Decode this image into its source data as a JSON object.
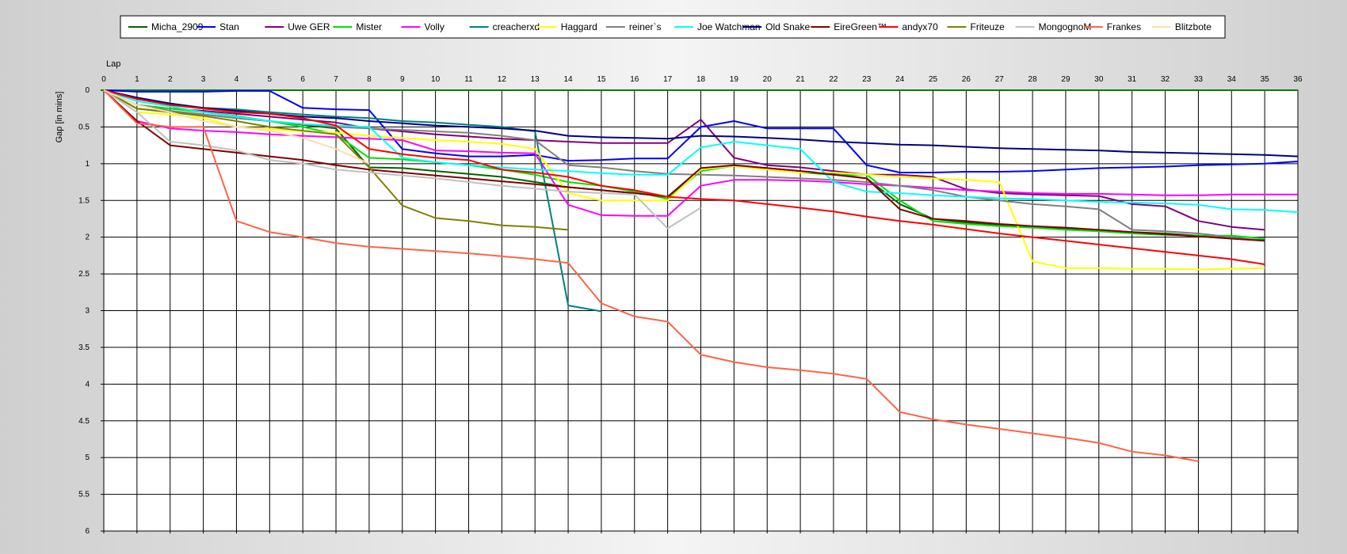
{
  "chart_data": {
    "type": "line",
    "title": "",
    "xlabel": "Lap",
    "ylabel": "Gap [in mins]",
    "xlim": [
      0,
      36
    ],
    "ylim": [
      0,
      6
    ],
    "y_inverted": true,
    "grid": true,
    "legend_position": "top",
    "x_ticks": [
      0,
      1,
      2,
      3,
      4,
      5,
      6,
      7,
      8,
      9,
      10,
      11,
      12,
      13,
      14,
      15,
      16,
      17,
      18,
      19,
      20,
      21,
      22,
      23,
      24,
      25,
      26,
      27,
      28,
      29,
      30,
      31,
      32,
      33,
      34,
      35,
      36
    ],
    "y_ticks": [
      0,
      0.5,
      1,
      1.5,
      2,
      2.5,
      3,
      3.5,
      4,
      4.5,
      5,
      5.5,
      6
    ],
    "y_tick_labels": [
      "0",
      "0.5",
      "1",
      "1.5",
      "2",
      "2.5",
      "3",
      "3.5",
      "4",
      "4.5",
      "5",
      "5.5",
      "6"
    ],
    "zero_line_color": "#008000",
    "series": [
      {
        "name": "Micha_2909",
        "color": "#006400",
        "x": [
          0,
          1,
          2,
          3,
          4,
          5,
          6,
          7,
          8,
          9,
          10,
          11,
          12,
          13,
          14,
          15,
          16,
          17,
          18,
          19,
          20,
          21,
          22,
          23,
          24,
          25,
          26,
          27,
          28,
          29,
          30,
          31,
          32,
          33,
          34,
          35
        ],
        "y": [
          0,
          0.25,
          0.3,
          0.33,
          0.38,
          0.42,
          0.47,
          0.52,
          1.05,
          1.06,
          1.1,
          1.14,
          1.18,
          1.25,
          1.32,
          1.36,
          1.4,
          1.45,
          1.1,
          1.02,
          1.06,
          1.1,
          1.14,
          1.2,
          1.55,
          1.75,
          1.8,
          1.83,
          1.86,
          1.88,
          1.9,
          1.93,
          1.95,
          1.98,
          2.02,
          2.04
        ]
      },
      {
        "name": "Stan",
        "color": "#0000ff",
        "x": [
          0,
          1,
          2,
          3,
          4,
          5,
          6,
          7,
          8,
          9,
          10,
          11,
          12,
          13,
          14,
          15,
          16,
          17,
          18,
          19,
          20,
          21,
          22,
          23,
          24,
          25,
          26,
          27,
          28,
          29,
          30,
          31,
          32,
          33,
          34,
          35,
          36
        ],
        "y": [
          0,
          0.02,
          0.02,
          0.02,
          0.01,
          0.01,
          0.24,
          0.26,
          0.27,
          0.8,
          0.86,
          0.9,
          0.9,
          0.88,
          0.96,
          0.95,
          0.93,
          0.93,
          0.5,
          0.42,
          0.52,
          0.52,
          0.52,
          1.02,
          1.12,
          1.12,
          1.11,
          1.11,
          1.1,
          1.08,
          1.06,
          1.05,
          1.04,
          1.02,
          1.01,
          1.0,
          0.97
        ]
      },
      {
        "name": "Uwe GER",
        "color": "#800080",
        "x": [
          0,
          1,
          2,
          3,
          4,
          5,
          6,
          7,
          8,
          9,
          10,
          11,
          12,
          13,
          14,
          15,
          16,
          17,
          18,
          19,
          20,
          21,
          22,
          23,
          24,
          25,
          26,
          27,
          28,
          29,
          30,
          31,
          32,
          33,
          34,
          35
        ],
        "y": [
          0,
          0.2,
          0.25,
          0.28,
          0.32,
          0.36,
          0.4,
          0.44,
          0.52,
          0.56,
          0.6,
          0.63,
          0.66,
          0.68,
          0.7,
          0.72,
          0.72,
          0.72,
          0.4,
          0.92,
          1.02,
          1.05,
          1.1,
          1.15,
          1.15,
          1.18,
          1.35,
          1.4,
          1.42,
          1.43,
          1.44,
          1.55,
          1.58,
          1.78,
          1.86,
          1.9
        ]
      },
      {
        "name": "Mister",
        "color": "#00e000",
        "x": [
          0,
          1,
          2,
          3,
          4,
          5,
          6,
          7,
          8,
          9,
          10,
          11,
          12,
          13,
          14,
          15,
          16,
          17,
          18,
          19,
          20,
          21,
          22,
          23,
          24,
          25,
          26,
          27,
          28,
          29,
          30,
          31,
          32,
          33,
          34,
          35
        ],
        "y": [
          0,
          0.2,
          0.25,
          0.3,
          0.35,
          0.42,
          0.5,
          0.6,
          0.92,
          0.94,
          0.98,
          1.02,
          1.08,
          1.15,
          1.25,
          1.3,
          1.38,
          1.48,
          1.1,
          1.03,
          1.08,
          1.12,
          1.15,
          1.15,
          1.5,
          1.78,
          1.82,
          1.85,
          1.87,
          1.9,
          1.92,
          1.95,
          1.97,
          1.98,
          1.98,
          2.02
        ]
      },
      {
        "name": "Volly",
        "color": "#ff00ff",
        "x": [
          0,
          1,
          2,
          3,
          4,
          5,
          6,
          7,
          8,
          9,
          10,
          11,
          12,
          13,
          14,
          15,
          16,
          17,
          18,
          19,
          20,
          21,
          22,
          23,
          24,
          25,
          26,
          27,
          28,
          29,
          30,
          31,
          32,
          33,
          34,
          35,
          36
        ],
        "y": [
          0,
          0.42,
          0.52,
          0.55,
          0.57,
          0.6,
          0.62,
          0.64,
          0.66,
          0.68,
          0.82,
          0.83,
          0.85,
          0.86,
          1.56,
          1.7,
          1.71,
          1.71,
          1.3,
          1.22,
          1.22,
          1.23,
          1.25,
          1.28,
          1.3,
          1.33,
          1.36,
          1.38,
          1.4,
          1.41,
          1.41,
          1.42,
          1.43,
          1.43,
          1.42,
          1.42,
          1.42
        ]
      },
      {
        "name": "creacherxd",
        "color": "#008080",
        "x": [
          0,
          1,
          2,
          3,
          4,
          5,
          6,
          7,
          8,
          9,
          10,
          11,
          12,
          13,
          14,
          15
        ],
        "y": [
          0,
          0.1,
          0.18,
          0.24,
          0.26,
          0.3,
          0.33,
          0.36,
          0.38,
          0.42,
          0.44,
          0.47,
          0.5,
          0.56,
          2.93,
          3.01
        ]
      },
      {
        "name": "Haggard",
        "color": "#ffff00",
        "x": [
          0,
          1,
          2,
          3,
          4,
          5,
          6,
          7,
          8,
          9,
          10,
          11,
          12,
          13,
          14,
          15,
          16,
          17,
          18,
          19,
          20,
          21,
          22,
          23,
          24,
          25,
          26,
          27,
          28,
          29,
          30,
          31,
          32,
          33,
          34,
          35
        ],
        "y": [
          0,
          0.3,
          0.33,
          0.38,
          0.5,
          0.53,
          0.56,
          0.58,
          0.62,
          0.65,
          0.68,
          0.7,
          0.73,
          0.8,
          1.4,
          1.5,
          1.5,
          1.5,
          1.08,
          1.03,
          1.08,
          1.12,
          1.12,
          1.15,
          1.18,
          1.2,
          1.22,
          1.25,
          2.33,
          2.42,
          2.42,
          2.43,
          2.43,
          2.44,
          2.43,
          2.42
        ]
      },
      {
        "name": "reiner`s",
        "color": "#808080",
        "x": [
          0,
          1,
          2,
          3,
          4,
          5,
          6,
          7,
          8,
          9,
          10,
          11,
          12,
          13,
          14,
          15,
          16,
          17,
          18,
          19,
          20,
          21,
          22,
          23,
          24,
          25,
          26,
          27,
          28,
          29,
          30,
          31,
          32,
          33,
          34,
          35
        ],
        "y": [
          0,
          0.2,
          0.28,
          0.33,
          0.38,
          0.42,
          0.46,
          0.5,
          0.52,
          0.54,
          0.56,
          0.58,
          0.62,
          0.68,
          1.02,
          1.05,
          1.1,
          1.14,
          1.15,
          1.16,
          1.18,
          1.2,
          1.22,
          1.25,
          1.3,
          1.36,
          1.45,
          1.5,
          1.55,
          1.58,
          1.62,
          1.9,
          1.92,
          1.95,
          2.0,
          2.05
        ]
      },
      {
        "name": "Joe Watchman",
        "color": "#00ffff",
        "x": [
          0,
          1,
          2,
          3,
          4,
          5,
          6,
          7,
          8,
          9,
          10,
          11,
          12,
          13,
          14,
          15,
          16,
          17,
          18,
          19,
          20,
          21,
          22,
          23,
          24,
          25,
          26,
          27,
          28,
          29,
          30,
          31,
          32,
          33,
          34,
          35,
          36
        ],
        "y": [
          0,
          0.15,
          0.22,
          0.3,
          0.36,
          0.42,
          0.46,
          0.48,
          0.5,
          0.92,
          0.98,
          1.02,
          1.05,
          1.08,
          1.1,
          1.13,
          1.15,
          1.15,
          0.78,
          0.7,
          0.75,
          0.8,
          1.25,
          1.38,
          1.4,
          1.43,
          1.45,
          1.47,
          1.48,
          1.5,
          1.52,
          1.53,
          1.54,
          1.56,
          1.62,
          1.63,
          1.66
        ]
      },
      {
        "name": "Old Snake",
        "color": "#000080",
        "x": [
          0,
          1,
          2,
          3,
          4,
          5,
          6,
          7,
          8,
          9,
          10,
          11,
          12,
          13,
          14,
          15,
          16,
          17,
          18,
          19,
          20,
          21,
          22,
          23,
          24,
          25,
          26,
          27,
          28,
          29,
          30,
          31,
          32,
          33,
          34,
          35,
          36
        ],
        "y": [
          0,
          0.1,
          0.18,
          0.24,
          0.28,
          0.32,
          0.36,
          0.38,
          0.42,
          0.45,
          0.48,
          0.5,
          0.52,
          0.55,
          0.62,
          0.64,
          0.65,
          0.66,
          0.62,
          0.63,
          0.65,
          0.67,
          0.7,
          0.72,
          0.74,
          0.75,
          0.77,
          0.79,
          0.8,
          0.81,
          0.82,
          0.84,
          0.85,
          0.86,
          0.87,
          0.88,
          0.9
        ]
      },
      {
        "name": "EireGreen™",
        "color": "#800000",
        "x": [
          0,
          1,
          2,
          3,
          4,
          5,
          6,
          7,
          8,
          9,
          10,
          11,
          12,
          13,
          14,
          15,
          16,
          17,
          18,
          19,
          20,
          21,
          22,
          23,
          24,
          25,
          26,
          27,
          28,
          29,
          30,
          31,
          32,
          33,
          34,
          35
        ],
        "y": [
          0,
          0.42,
          0.75,
          0.8,
          0.85,
          0.9,
          0.95,
          1.02,
          1.08,
          1.12,
          1.16,
          1.2,
          1.24,
          1.28,
          1.32,
          1.36,
          1.4,
          1.45,
          1.06,
          1.02,
          1.06,
          1.1,
          1.15,
          1.2,
          1.62,
          1.75,
          1.78,
          1.82,
          1.85,
          1.87,
          1.9,
          1.93,
          1.96,
          1.99,
          2.02,
          2.05
        ]
      },
      {
        "name": "andyx70",
        "color": "#ff0000",
        "x": [
          0,
          1,
          2,
          3,
          4,
          5,
          6,
          7,
          8,
          9,
          10,
          11,
          12,
          13,
          14,
          15,
          16,
          17,
          18,
          19,
          20,
          21,
          22,
          23,
          24,
          25,
          26,
          27,
          28,
          29,
          30,
          31,
          32,
          33,
          34,
          35
        ],
        "y": [
          0,
          0.12,
          0.2,
          0.25,
          0.3,
          0.32,
          0.38,
          0.48,
          0.8,
          0.87,
          0.92,
          0.95,
          1.08,
          1.12,
          1.18,
          1.3,
          1.36,
          1.45,
          1.48,
          1.5,
          1.55,
          1.6,
          1.65,
          1.72,
          1.78,
          1.83,
          1.89,
          1.95,
          2.0,
          2.05,
          2.1,
          2.15,
          2.2,
          2.25,
          2.3,
          2.37
        ]
      },
      {
        "name": "Friteuze",
        "color": "#808000",
        "x": [
          0,
          1,
          2,
          3,
          4,
          5,
          6,
          7,
          8,
          9,
          10,
          11,
          12,
          13,
          14
        ],
        "y": [
          0,
          0.25,
          0.3,
          0.35,
          0.42,
          0.5,
          0.55,
          0.6,
          1.05,
          1.57,
          1.74,
          1.78,
          1.84,
          1.86,
          1.9
        ]
      },
      {
        "name": "MongognoM",
        "color": "#c0c0c0",
        "x": [
          0,
          1,
          2,
          3,
          4,
          5,
          6,
          7,
          8,
          9,
          10,
          11,
          12,
          13,
          14,
          15,
          16,
          17,
          18
        ],
        "y": [
          0,
          0.3,
          0.7,
          0.75,
          0.82,
          0.95,
          1.0,
          1.08,
          1.12,
          1.16,
          1.2,
          1.25,
          1.3,
          1.34,
          1.38,
          1.4,
          1.42,
          1.88,
          1.6
        ]
      },
      {
        "name": "Frankes",
        "color": "#ff6347",
        "x": [
          0,
          1,
          2,
          3,
          4,
          5,
          6,
          7,
          8,
          9,
          10,
          11,
          12,
          13,
          14,
          15,
          16,
          17,
          18,
          19,
          20,
          21,
          22,
          23,
          24,
          25,
          26,
          27,
          28,
          29,
          30,
          31,
          32,
          33
        ],
        "y": [
          0,
          0.45,
          0.5,
          0.5,
          1.78,
          1.93,
          2.0,
          2.08,
          2.13,
          2.16,
          2.19,
          2.22,
          2.26,
          2.3,
          2.35,
          2.9,
          3.08,
          3.15,
          3.6,
          3.7,
          3.77,
          3.81,
          3.86,
          3.93,
          4.38,
          4.48,
          4.55,
          4.61,
          4.67,
          4.73,
          4.8,
          4.92,
          4.97,
          5.05
        ]
      },
      {
        "name": "Blitzbote",
        "color": "#ffdead",
        "x": [
          0,
          1,
          2,
          3,
          4,
          5,
          6,
          7,
          8
        ],
        "y": [
          0,
          0.2,
          0.3,
          0.42,
          0.5,
          0.55,
          0.65,
          0.8,
          1.0
        ]
      }
    ]
  }
}
